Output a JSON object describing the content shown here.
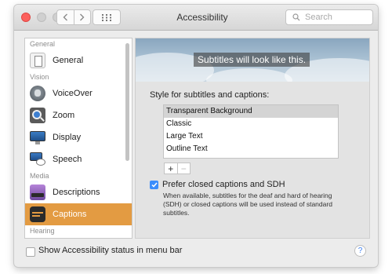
{
  "window": {
    "title": "Accessibility"
  },
  "search": {
    "placeholder": "Search"
  },
  "sidebar": {
    "sections": [
      {
        "category": "General",
        "items": [
          {
            "label": "General",
            "icon": "general-icon"
          }
        ]
      },
      {
        "category": "Vision",
        "items": [
          {
            "label": "VoiceOver",
            "icon": "voiceover-icon"
          },
          {
            "label": "Zoom",
            "icon": "zoom-icon"
          },
          {
            "label": "Display",
            "icon": "display-icon"
          },
          {
            "label": "Speech",
            "icon": "speech-icon"
          }
        ]
      },
      {
        "category": "Media",
        "items": [
          {
            "label": "Descriptions",
            "icon": "descriptions-icon"
          },
          {
            "label": "Captions",
            "icon": "captions-icon",
            "selected": true
          }
        ]
      },
      {
        "category": "Hearing",
        "items": []
      }
    ]
  },
  "preview": {
    "sample_text": "Subtitles will look like this."
  },
  "captions": {
    "style_label": "Style for subtitles and captions:",
    "styles": [
      "Transparent Background",
      "Classic",
      "Large Text",
      "Outline Text"
    ],
    "selected_style": "Transparent Background",
    "add_label": "+",
    "remove_label": "−",
    "prefer_sdh_label": "Prefer closed captions and SDH",
    "prefer_sdh_checked": true,
    "description": "When available, subtitles for the deaf and hard of hearing (SDH) or closed captions will be used instead of standard subtitles."
  },
  "footer": {
    "status_menu_label": "Show Accessibility status in menu bar",
    "status_menu_checked": false,
    "help_label": "?"
  },
  "colors": {
    "selection": "#e39b42",
    "checkbox": "#3b8dfc",
    "close_light": "#fc605c"
  }
}
